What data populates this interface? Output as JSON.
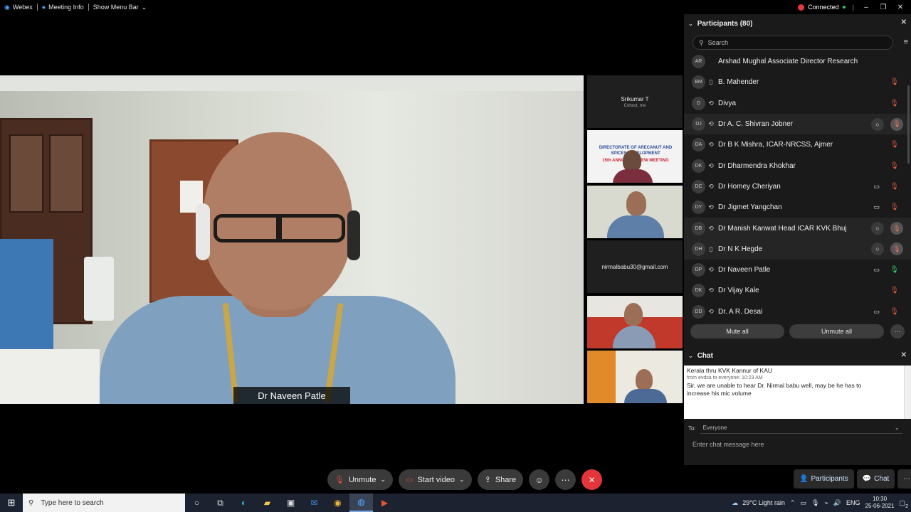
{
  "titlebar": {
    "app_name": "Webex",
    "meeting_info": "Meeting Info",
    "show_menu": "Show Menu Bar",
    "status": "Connected"
  },
  "main_video": {
    "speaker_name": "Dr Naveen Patle"
  },
  "thumbnails": [
    {
      "name": "Srikumar T",
      "sub": "Cohost, me"
    },
    {
      "banner_line1": "DIRECTORATE OF ARECANUT AND",
      "banner_line2": "SPICES DEVELOPMENT",
      "banner_line3": "15th ANNUAL REVIEW MEETING"
    },
    {},
    {
      "name": "nirmalbabu30@gmail.com"
    },
    {},
    {}
  ],
  "participants": {
    "title": "Participants (80)",
    "search_placeholder": "Search",
    "items": [
      {
        "initials": "AR",
        "name": "Arshad Mughal Associate Director Research",
        "device": "",
        "mic": "",
        "cam": false,
        "chat_btn": false,
        "mic_btn": false,
        "highlight": false
      },
      {
        "initials": "BM",
        "name": "B. Mahender",
        "device": "phone",
        "mic": "muted",
        "cam": false,
        "chat_btn": false,
        "mic_btn": false,
        "highlight": false
      },
      {
        "initials": "D",
        "name": "Divya",
        "device": "web",
        "mic": "muted",
        "cam": false,
        "chat_btn": false,
        "mic_btn": false,
        "highlight": false
      },
      {
        "initials": "DJ",
        "name": "Dr A. C. Shivran Jobner",
        "device": "web",
        "mic": "muted",
        "cam": false,
        "chat_btn": true,
        "mic_btn": true,
        "highlight": true
      },
      {
        "initials": "DA",
        "name": "Dr B K Mishra, ICAR-NRCSS, Ajmer",
        "device": "web",
        "mic": "muted",
        "cam": false,
        "chat_btn": false,
        "mic_btn": false,
        "highlight": false
      },
      {
        "initials": "DK",
        "name": "Dr Dharmendra Khokhar",
        "device": "web",
        "mic": "muted",
        "cam": false,
        "chat_btn": false,
        "mic_btn": false,
        "highlight": false
      },
      {
        "initials": "DC",
        "name": "Dr Homey Cheriyan",
        "device": "web",
        "mic": "muted",
        "cam": true,
        "chat_btn": false,
        "mic_btn": false,
        "highlight": false
      },
      {
        "initials": "DY",
        "name": "Dr Jigmet Yangchan",
        "device": "web",
        "mic": "muted",
        "cam": true,
        "chat_btn": false,
        "mic_btn": false,
        "highlight": false
      },
      {
        "initials": "DB",
        "name": "Dr Manish Kanwat Head ICAR KVK Bhuj",
        "device": "web",
        "mic": "muted",
        "cam": false,
        "chat_btn": true,
        "mic_btn": true,
        "highlight": true
      },
      {
        "initials": "DH",
        "name": "Dr N K Hegde",
        "device": "phone",
        "mic": "muted",
        "cam": false,
        "chat_btn": true,
        "mic_btn": true,
        "highlight": true
      },
      {
        "initials": "DP",
        "name": "Dr Naveen Patle",
        "device": "web",
        "mic": "on",
        "cam": true,
        "chat_btn": false,
        "mic_btn": false,
        "highlight": false
      },
      {
        "initials": "DK",
        "name": "Dr Vijay Kale",
        "device": "web",
        "mic": "muted",
        "cam": false,
        "chat_btn": false,
        "mic_btn": false,
        "highlight": false
      },
      {
        "initials": "DD",
        "name": "Dr. A R. Desai",
        "device": "web",
        "mic": "muted",
        "cam": true,
        "chat_btn": false,
        "mic_btn": false,
        "highlight": false
      }
    ],
    "mute_all": "Mute all",
    "unmute_all": "Unmute all"
  },
  "chat": {
    "title": "Chat",
    "messages": [
      {
        "text": "Kerala thru KVK Kannur of KAU"
      },
      {
        "meta": "from evdsa to everyone:    10:23 AM"
      },
      {
        "text": "Sir, we are unable to hear Dr. Nirmal babu well, may be he has to"
      },
      {
        "text": "increase his mic volume"
      }
    ],
    "to_label": "To:",
    "to_value": "Everyone",
    "input_placeholder": "Enter chat message here"
  },
  "controls": {
    "unmute": "Unmute",
    "start_video": "Start video",
    "share": "Share"
  },
  "panel_tabs": {
    "participants": "Participants",
    "chat": "Chat"
  },
  "taskbar": {
    "search_placeholder": "Type here to search",
    "weather": "29°C  Light rain",
    "lang": "ENG",
    "time": "10:30",
    "date": "25-06-2021",
    "notif_count": "2"
  },
  "colors": {
    "accent_red": "#e4363a",
    "mic_muted": "#e05a3a",
    "mic_on": "#39d46a",
    "panel_bg": "#1a1a1a"
  }
}
